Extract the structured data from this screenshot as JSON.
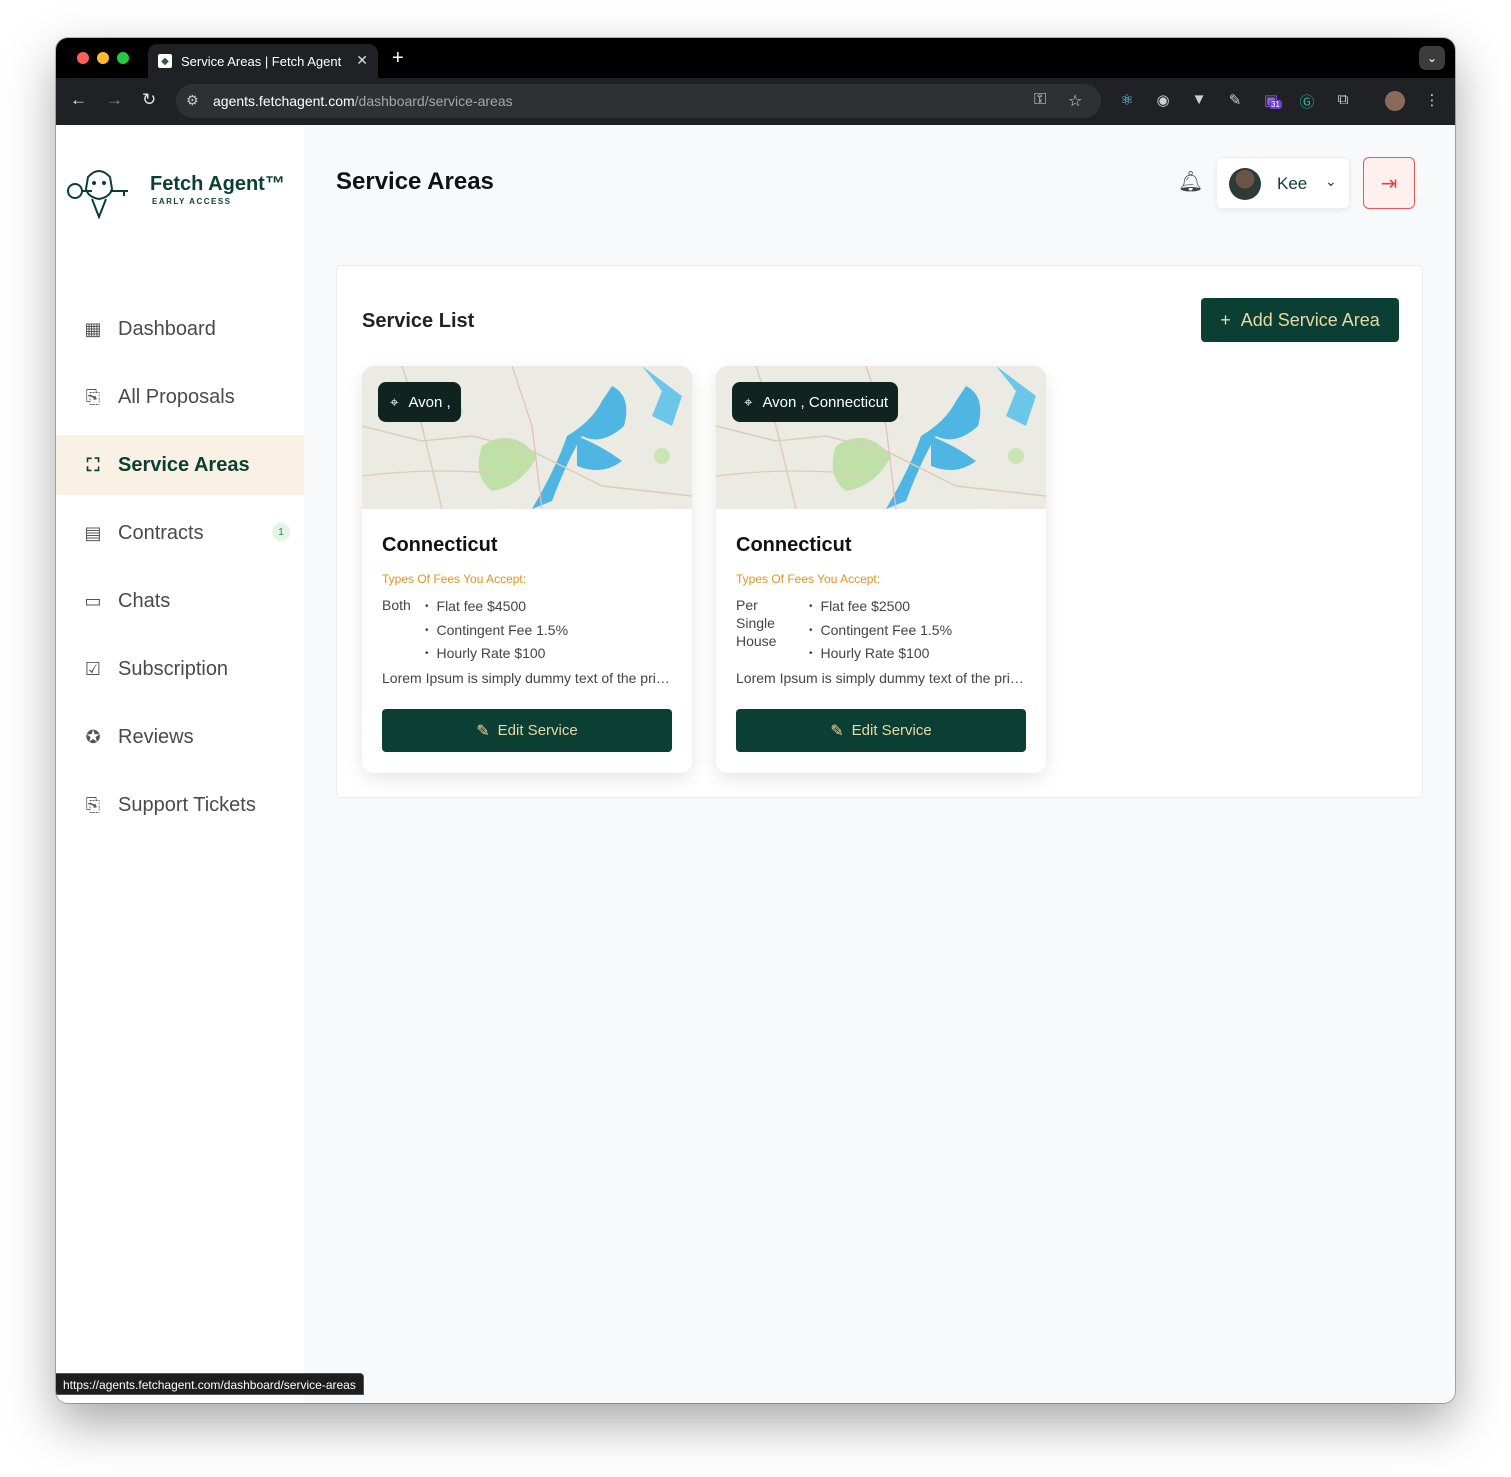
{
  "browser": {
    "tab_title": "Service Areas | Fetch Agent",
    "url_host": "agents.fetchagent.com",
    "url_path": "/dashboard/service-areas",
    "status_url": "https://agents.fetchagent.com/dashboard/service-areas",
    "extension_badge": "31"
  },
  "brand": {
    "name": "Fetch Agent™",
    "sub": "EARLY ACCESS",
    "color_primary": "#0c3f33",
    "color_accent": "#e9d8a6",
    "color_fee_label": "#e0931e"
  },
  "sidebar": {
    "items": [
      {
        "label": "Dashboard",
        "icon": "grid-icon"
      },
      {
        "label": "All Proposals",
        "icon": "proposal-icon"
      },
      {
        "label": "Service Areas",
        "icon": "area-icon",
        "active": true
      },
      {
        "label": "Contracts",
        "icon": "contract-icon",
        "badge": "1"
      },
      {
        "label": "Chats",
        "icon": "chat-icon"
      },
      {
        "label": "Subscription",
        "icon": "checkbox-icon"
      },
      {
        "label": "Reviews",
        "icon": "star-icon"
      },
      {
        "label": "Support Tickets",
        "icon": "ticket-icon"
      }
    ]
  },
  "header": {
    "title": "Service Areas",
    "user_name": "Kee"
  },
  "panel": {
    "title": "Service List",
    "add_button": "Add Service Area"
  },
  "cards": [
    {
      "location": "Avon ,",
      "title": "Connecticut",
      "fees_label": "Types Of Fees You Accept:",
      "fee_type": "Both",
      "fees": [
        "Flat fee $4500",
        "Contingent Fee 1.5%",
        "Hourly Rate $100"
      ],
      "description": "Lorem Ipsum is simply dummy text of the printing and typesetting industry.",
      "edit_label": "Edit Service"
    },
    {
      "location": "Avon , Connecticut",
      "title": "Connecticut",
      "fees_label": "Types Of Fees You Accept:",
      "fee_type": "Per Single House",
      "fees": [
        "Flat fee $2500",
        "Contingent Fee 1.5%",
        "Hourly Rate $100"
      ],
      "description": "Lorem Ipsum is simply dummy text of the printing and typesetting industry.",
      "edit_label": "Edit Service"
    }
  ]
}
